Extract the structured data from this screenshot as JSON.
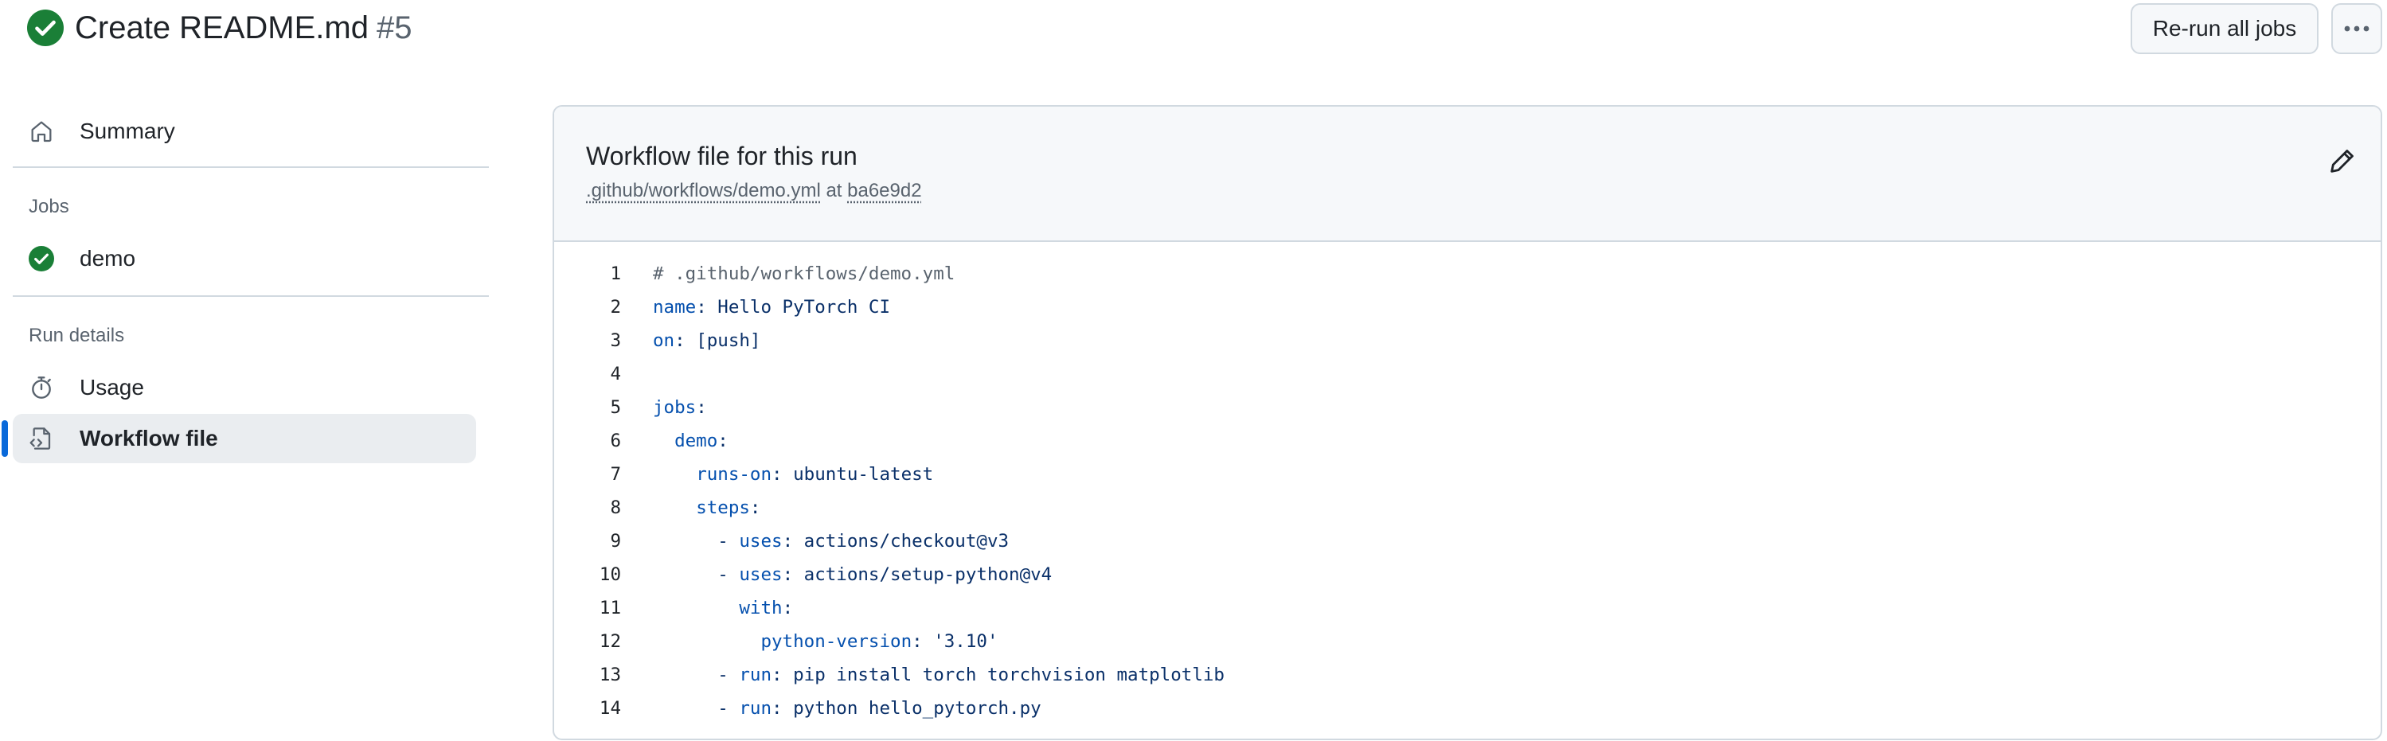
{
  "header": {
    "title": "Create README.md",
    "run_number": "#5",
    "rerun_label": "Re-run all jobs"
  },
  "sidebar": {
    "summary_label": "Summary",
    "jobs_heading": "Jobs",
    "jobs": [
      {
        "label": "demo",
        "status": "success"
      }
    ],
    "run_details_heading": "Run details",
    "usage_label": "Usage",
    "workflow_file_label": "Workflow file"
  },
  "workflow": {
    "title": "Workflow file for this run",
    "path": ".github/workflows/demo.yml",
    "at_text": "at",
    "commit": "ba6e9d2",
    "lines": [
      {
        "no": "1",
        "indent": "",
        "dash": "",
        "key": "",
        "sep": "",
        "value": "",
        "comment": "# .github/workflows/demo.yml"
      },
      {
        "no": "2",
        "indent": "",
        "dash": "",
        "key": "name",
        "sep": ": ",
        "value": "Hello PyTorch CI",
        "comment": ""
      },
      {
        "no": "3",
        "indent": "",
        "dash": "",
        "key": "on",
        "sep": ": ",
        "value": "[push]",
        "comment": ""
      },
      {
        "no": "4",
        "indent": "",
        "dash": "",
        "key": "",
        "sep": "",
        "value": "",
        "comment": ""
      },
      {
        "no": "5",
        "indent": "",
        "dash": "",
        "key": "jobs",
        "sep": ":",
        "value": "",
        "comment": ""
      },
      {
        "no": "6",
        "indent": "  ",
        "dash": "",
        "key": "demo",
        "sep": ":",
        "value": "",
        "comment": ""
      },
      {
        "no": "7",
        "indent": "    ",
        "dash": "",
        "key": "runs-on",
        "sep": ": ",
        "value": "ubuntu-latest",
        "comment": ""
      },
      {
        "no": "8",
        "indent": "    ",
        "dash": "",
        "key": "steps",
        "sep": ":",
        "value": "",
        "comment": ""
      },
      {
        "no": "9",
        "indent": "      ",
        "dash": "- ",
        "key": "uses",
        "sep": ": ",
        "value": "actions/checkout@v3",
        "comment": ""
      },
      {
        "no": "10",
        "indent": "      ",
        "dash": "- ",
        "key": "uses",
        "sep": ": ",
        "value": "actions/setup-python@v4",
        "comment": ""
      },
      {
        "no": "11",
        "indent": "        ",
        "dash": "",
        "key": "with",
        "sep": ":",
        "value": "",
        "comment": ""
      },
      {
        "no": "12",
        "indent": "          ",
        "dash": "",
        "key": "python-version",
        "sep": ": ",
        "value": "'3.10'",
        "comment": ""
      },
      {
        "no": "13",
        "indent": "      ",
        "dash": "- ",
        "key": "run",
        "sep": ": ",
        "value": "pip install torch torchvision matplotlib",
        "comment": ""
      },
      {
        "no": "14",
        "indent": "      ",
        "dash": "- ",
        "key": "run",
        "sep": ": ",
        "value": "python hello_pytorch.py",
        "comment": ""
      }
    ]
  },
  "icons": {
    "run_status": "check-circle-fill-icon",
    "summary": "home-icon",
    "job_status": "check-circle-fill-icon",
    "usage": "stopwatch-icon",
    "workflow_file": "file-code-icon",
    "edit": "pencil-icon",
    "more": "kebab-horizontal-icon"
  },
  "colors": {
    "success": "#1a7f37",
    "accent": "#0969da",
    "yaml_key": "#0550ae",
    "yaml_value": "#0a3069",
    "comment": "#59636e"
  }
}
